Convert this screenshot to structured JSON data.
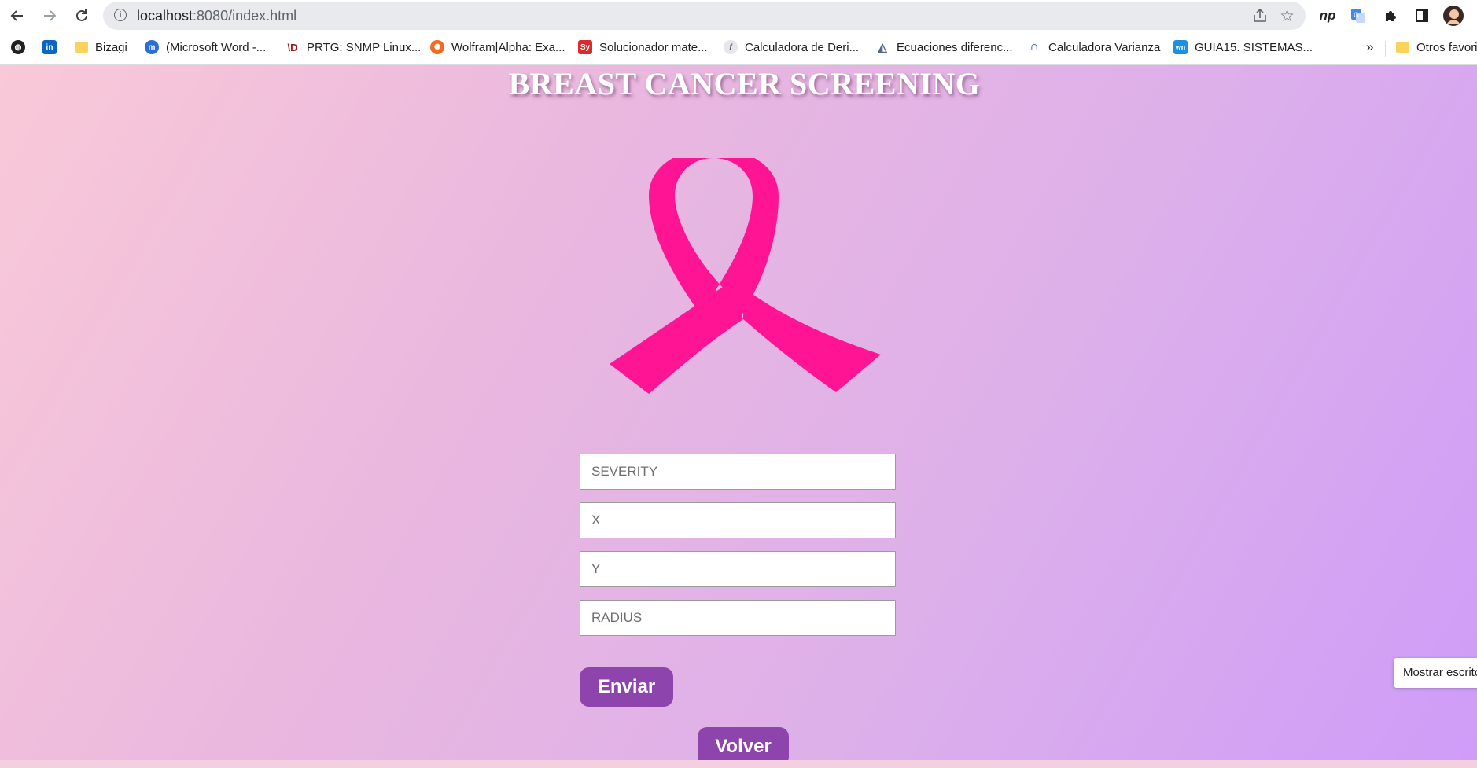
{
  "browser": {
    "url_host": "localhost",
    "url_rest": ":8080/index.html",
    "bookmarks": [
      {
        "label": "",
        "icon": "globe-icon"
      },
      {
        "label": "",
        "icon": "linkedin-icon"
      },
      {
        "label": "Bizagi",
        "icon": "folder-icon"
      },
      {
        "label": "(Microsoft Word -...",
        "icon": "microsoft-word-icon"
      },
      {
        "label": "PRTG: SNMP Linux...",
        "icon": "prtg-icon"
      },
      {
        "label": "Wolfram|Alpha: Exa...",
        "icon": "wolfram-icon"
      },
      {
        "label": "Solucionador mate...",
        "icon": "symbolab-icon"
      },
      {
        "label": "Calculadora de Deri...",
        "icon": "derivative-calculator-icon"
      },
      {
        "label": "Ecuaciones diferenc...",
        "icon": "equations-icon"
      },
      {
        "label": "Calculadora Varianza",
        "icon": "variance-calculator-icon"
      },
      {
        "label": "GUIA15. SISTEMAS...",
        "icon": "wn-icon"
      }
    ],
    "more_bookmarks": "»",
    "other_bookmarks": "Otros favoritos"
  },
  "page": {
    "title": "BREAST CANCER SCREENING",
    "ribbon_icon": "pink-ribbon-icon",
    "ribbon_color": "#ff1493",
    "fields": [
      {
        "placeholder": "SEVERITY",
        "value": ""
      },
      {
        "placeholder": "X",
        "value": ""
      },
      {
        "placeholder": "Y",
        "value": ""
      },
      {
        "placeholder": "RADIUS",
        "value": ""
      }
    ],
    "submit_label": "Enviar",
    "back_label": "Volver",
    "button_color": "#8e44ad"
  },
  "toast": {
    "label": "Mostrar escritorio"
  }
}
